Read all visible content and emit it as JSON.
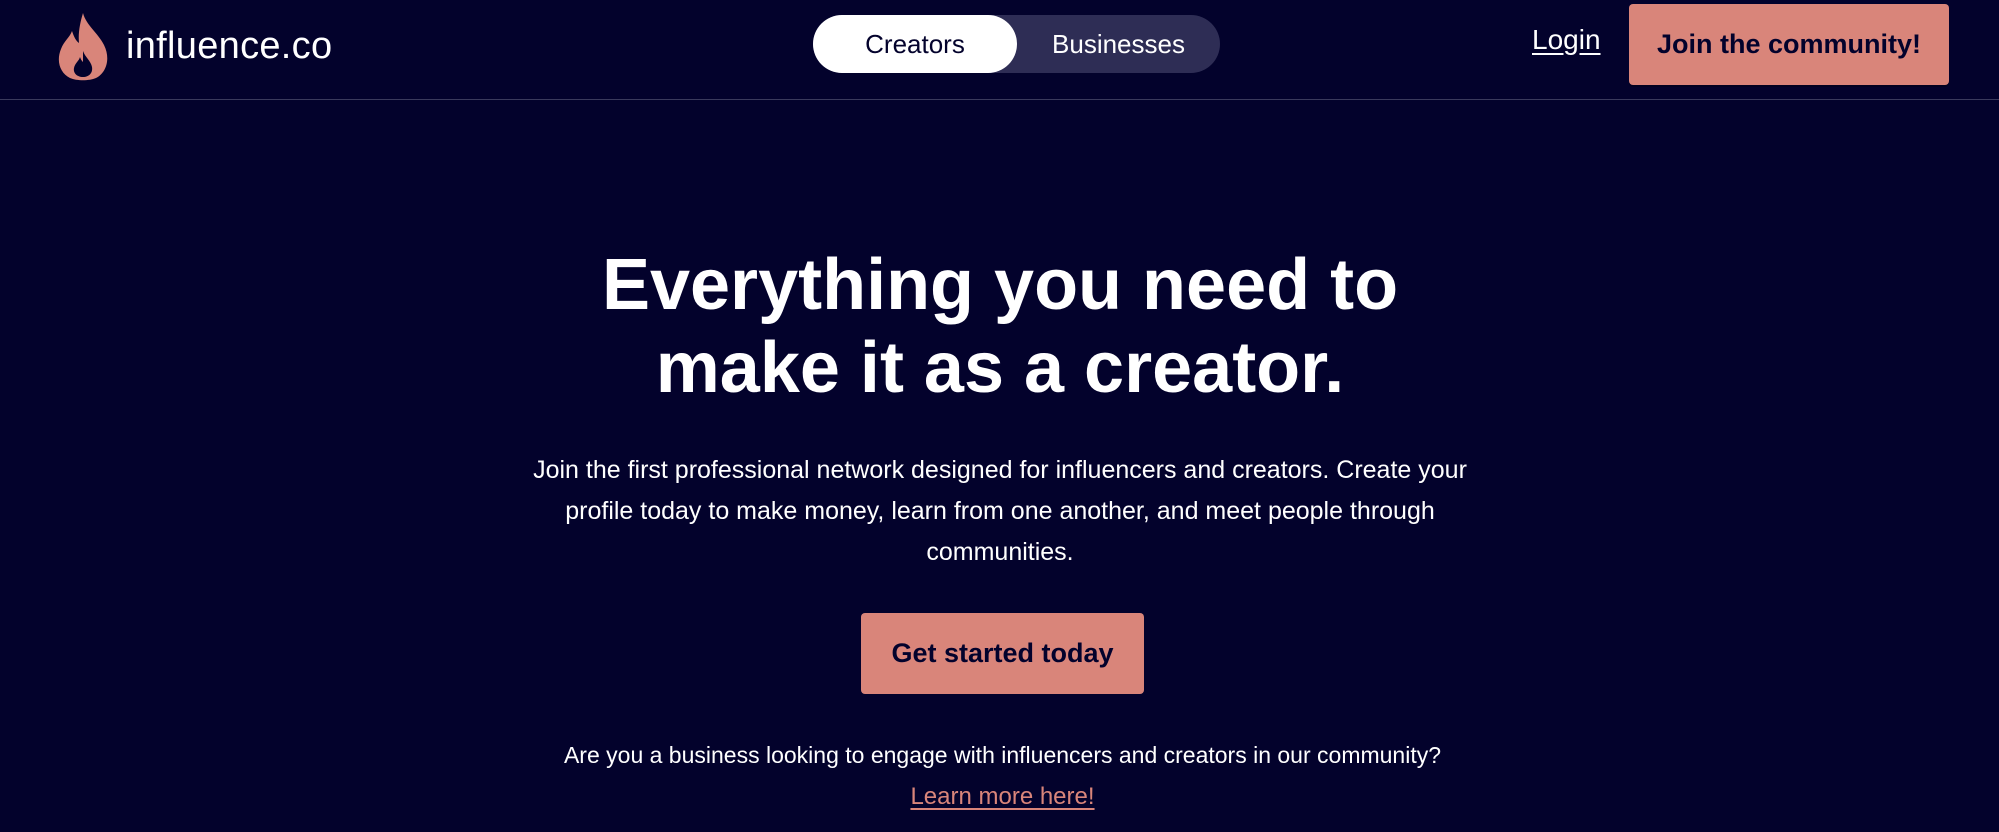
{
  "brand": {
    "name": "influence.co",
    "accent_color": "#d9857a",
    "background_color": "#03022c",
    "logo_icon": "flame-icon"
  },
  "header": {
    "toggle": {
      "options": [
        "Creators",
        "Businesses"
      ],
      "selected": "Creators"
    },
    "login_label": "Login",
    "join_label": "Join the community!"
  },
  "hero": {
    "title": "Everything you need to make it as a creator.",
    "subtitle": "Join the first professional network designed for influencers and creators. Create your profile today to make money, learn from one another, and meet people through communities.",
    "cta_label": "Get started today",
    "business_question": "Are you a business looking to engage with influencers and creators in our community?",
    "learn_more_label": "Learn more here!"
  }
}
